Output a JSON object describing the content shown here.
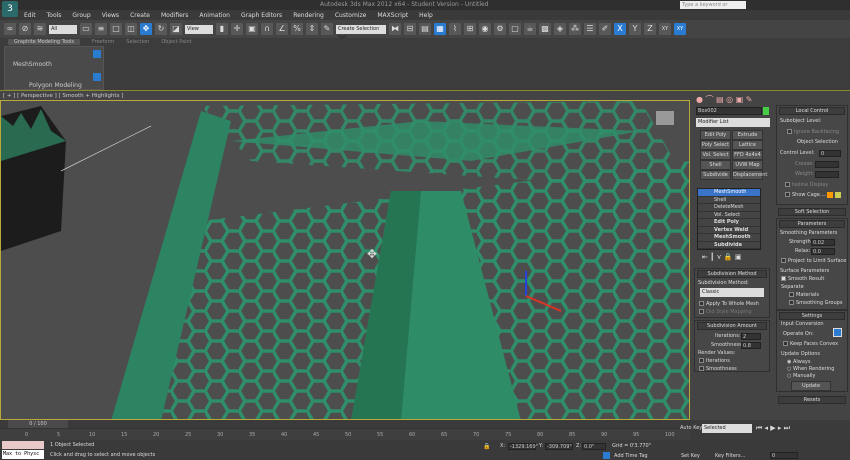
{
  "app": {
    "logo": "3",
    "title": "Autodesk 3ds Max 2012 x64 - Student Version - Untitled",
    "search_placeholder": "Type a keyword or phrase"
  },
  "menu": [
    "Edit",
    "Tools",
    "Group",
    "Views",
    "Create",
    "Modifiers",
    "Animation",
    "Graph Editors",
    "Rendering",
    "Customize",
    "MAXScript",
    "Help"
  ],
  "toolbar": {
    "selection_filter": "All",
    "ref_coord": "View",
    "named_sel": "Create Selection Set",
    "axis": [
      "X",
      "Y",
      "Z",
      "XY",
      "XY"
    ]
  },
  "ribbon": {
    "tabs": [
      "Graphite Modeling Tools",
      "Freeform",
      "Selection",
      "Object Paint"
    ],
    "item": "MeshSmooth",
    "group": "Polygon Modeling"
  },
  "viewport": {
    "label": "[ + ] [ Perspective ] [ Smooth + Highlights ]"
  },
  "command_panel": {
    "object_name": "Box002",
    "modifier_list": "Modifier List",
    "buttons": [
      "Edit Poly",
      "Extrude",
      "Poly Select",
      "Lattice",
      "Vol. Select",
      "FFD 4x4x4",
      "Shell",
      "UVW Map",
      "Subdivide",
      "Displacement"
    ],
    "stack": [
      {
        "label": "MeshSmooth",
        "selected": true
      },
      {
        "label": "Shell"
      },
      {
        "label": "DeleteMesh"
      },
      {
        "label": "Vol. Select"
      },
      {
        "label": "Edit Poly",
        "bold": true
      },
      {
        "label": "Vertex Weld",
        "bold": true
      },
      {
        "label": "MeshSmooth",
        "bold": true
      },
      {
        "label": "Subdivide",
        "bold": true
      }
    ],
    "subdivision_method": {
      "title": "Subdivision Method",
      "label": "Subdivision Method:",
      "value": "Classic",
      "apply_whole": "Apply To Whole Mesh",
      "old_mapping": "Old Style Mapping"
    },
    "subdivision_amount": {
      "title": "Subdivision Amount",
      "iterations_label": "Iterations:",
      "iterations": "2",
      "smoothness_label": "Smoothness:",
      "smoothness": "0.8",
      "render_values": "Render Values:",
      "r_iterations": "Iterations",
      "r_smoothness": "Smoothness"
    },
    "local_control": {
      "title": "Local Control",
      "subobject_level": "Subobject Level:",
      "ignore_backfacing": "Ignore Backfacing",
      "object_selection": "Object Selection",
      "control_level": "Control Level:",
      "control_value": "0",
      "crease": "Crease:",
      "weight": "Weight:",
      "isoline": "Isoline Display",
      "show_cage": "Show Cage......"
    },
    "soft_selection": "Soft Selection",
    "parameters": {
      "title": "Parameters",
      "smoothing": "Smoothing Parameters",
      "strength_label": "Strength:",
      "strength": "0.02",
      "relax_label": "Relax:",
      "relax": "0.0",
      "project": "Project to Limit Surface",
      "surface": "Surface Parameters",
      "smooth_result": "Smooth Result",
      "separate": "Separate",
      "materials": "Materials",
      "smoothing_groups": "Smoothing Groups"
    },
    "settings": {
      "title": "Settings",
      "input_conversion": "Input Conversion",
      "operate_on": "Operate On:",
      "keep_faces": "Keep Faces Convex",
      "update_options": "Update Options",
      "always": "Always",
      "when_rendering": "When Rendering",
      "manually": "Manually",
      "update": "Update"
    },
    "resets": "Resets"
  },
  "timeline": {
    "frame": "0 / 100",
    "ticks": [
      "0",
      "5",
      "10",
      "15",
      "20",
      "25",
      "30",
      "35",
      "40",
      "45",
      "50",
      "55",
      "60",
      "65",
      "70",
      "75",
      "80",
      "85",
      "90",
      "95",
      "100"
    ]
  },
  "status": {
    "maxscript": "Max to Physc",
    "selected": "1 Object Selected",
    "prompt": "Click and drag to select and move objects",
    "x": "-1329.169\"",
    "y": "-309.709\"",
    "z": "0.0\"",
    "grid": "Grid = 0'3.770\"",
    "add_time_tag": "Add Time Tag",
    "auto_key": "Auto Key",
    "set_key": "Set Key",
    "key_mode": "Selected",
    "key_filters": "Key Filters...",
    "frame_field": "0"
  },
  "colors": {
    "accent": "#2b7bd0",
    "mesh": "#2f8f6a",
    "viewport_border": "#b9a83a"
  }
}
